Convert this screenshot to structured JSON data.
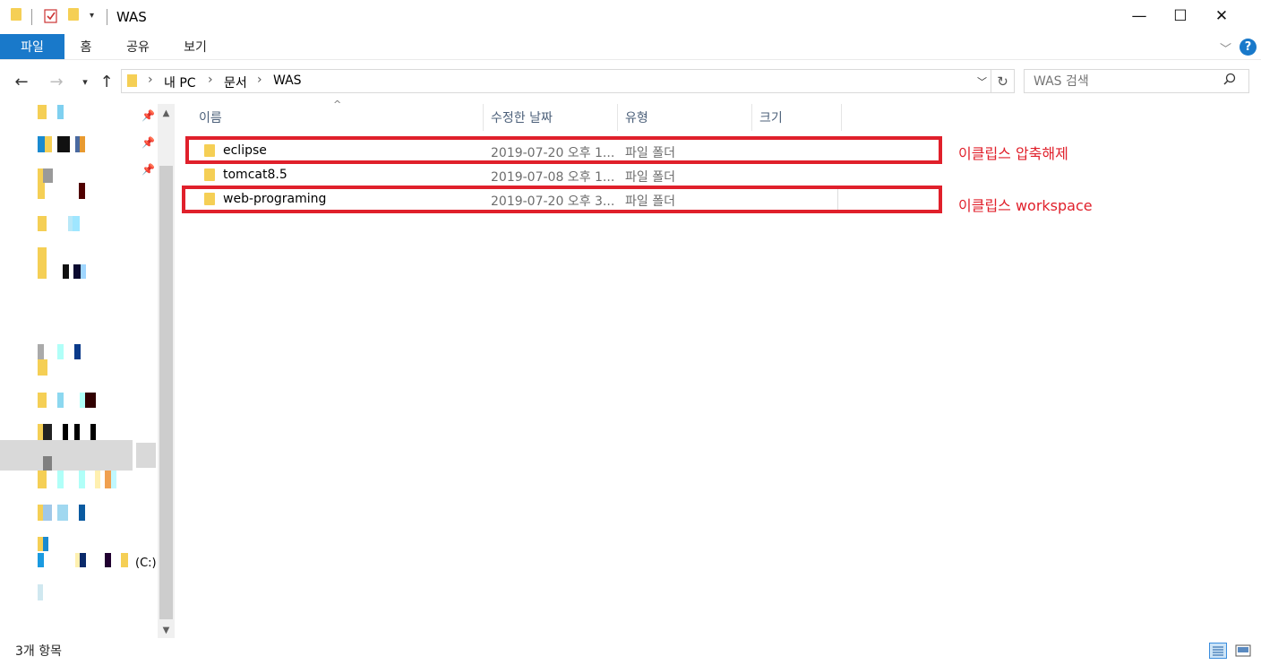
{
  "window": {
    "title": "WAS",
    "minimize_glyph": "—",
    "maximize_glyph": "☐",
    "close_glyph": "✕"
  },
  "ribbon": {
    "tabs": [
      {
        "label": "파일",
        "active": true
      },
      {
        "label": "홈"
      },
      {
        "label": "공유"
      },
      {
        "label": "보기"
      }
    ],
    "help_label": "?"
  },
  "address": {
    "breadcrumbs": [
      "내 PC",
      "문서",
      "WAS"
    ],
    "search_placeholder": "WAS 검색"
  },
  "navpane": {
    "drive_label": "(C:)"
  },
  "columns": [
    "이름",
    "수정한 날짜",
    "유형",
    "크기"
  ],
  "files": [
    {
      "name": "eclipse",
      "date": "2019-07-20 오후 1...",
      "type": "파일 폴더",
      "size": ""
    },
    {
      "name": "tomcat8.5",
      "date": "2019-07-08 오후 1...",
      "type": "파일 폴더",
      "size": ""
    },
    {
      "name": "web-programing",
      "date": "2019-07-20 오후 3...",
      "type": "파일 폴더",
      "size": ""
    }
  ],
  "annotations": {
    "eclipse_note": "이클립스 압축해제",
    "workspace_note": "이클립스 workspace",
    "color": "#e0202b"
  },
  "status": {
    "item_count": "3개 항목"
  },
  "colors": {
    "accent": "#1979ca",
    "folder": "#f5cf55"
  }
}
